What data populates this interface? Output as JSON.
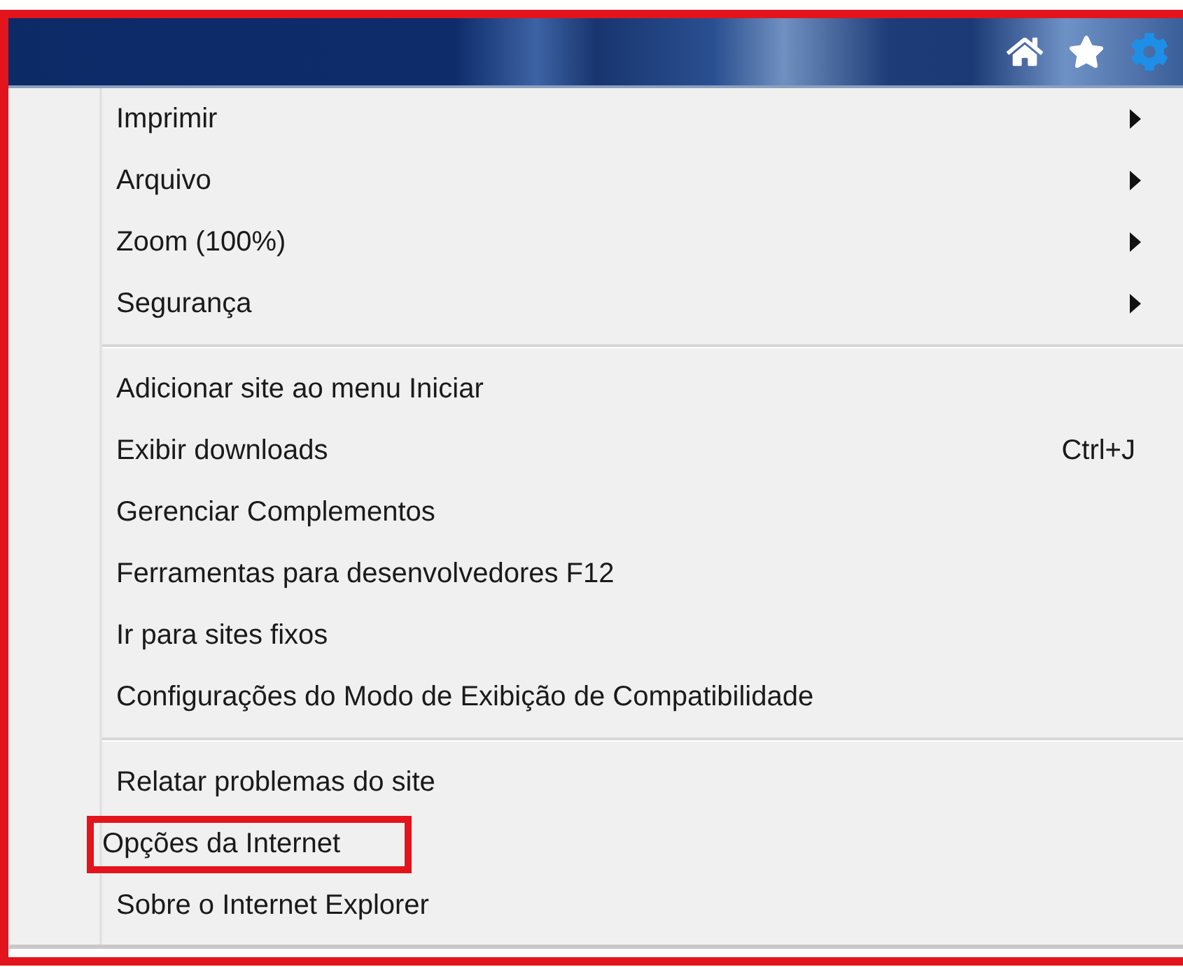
{
  "toolbar": {
    "icons": [
      {
        "kind": "home"
      },
      {
        "kind": "favorites"
      },
      {
        "kind": "settings"
      }
    ]
  },
  "menu": {
    "groups": [
      {
        "items": [
          {
            "label": "Imprimir",
            "submenu": true,
            "highlighted": false
          },
          {
            "label": "Arquivo",
            "submenu": true,
            "highlighted": false
          },
          {
            "label": "Zoom (100%)",
            "submenu": true,
            "highlighted": false
          },
          {
            "label": "Segurança",
            "submenu": true,
            "highlighted": false
          }
        ]
      },
      {
        "items": [
          {
            "label": "Adicionar site ao menu Iniciar",
            "submenu": false,
            "highlighted": false
          },
          {
            "label": "Exibir downloads",
            "shortcut": "Ctrl+J",
            "submenu": false,
            "highlighted": false
          },
          {
            "label": "Gerenciar Complementos",
            "submenu": false,
            "highlighted": false
          },
          {
            "label": "Ferramentas para desenvolvedores F12",
            "submenu": false,
            "highlighted": false
          },
          {
            "label": "Ir para sites fixos",
            "submenu": false,
            "highlighted": false
          },
          {
            "label": "Configurações do Modo de Exibição de Compatibilidade",
            "submenu": false,
            "highlighted": false
          }
        ]
      },
      {
        "items": [
          {
            "label": "Relatar problemas do site",
            "submenu": false,
            "highlighted": false
          },
          {
            "label": "Opções da Internet",
            "submenu": false,
            "highlighted": true
          },
          {
            "label": "Sobre o Internet Explorer",
            "submenu": false,
            "highlighted": false
          }
        ]
      }
    ]
  }
}
